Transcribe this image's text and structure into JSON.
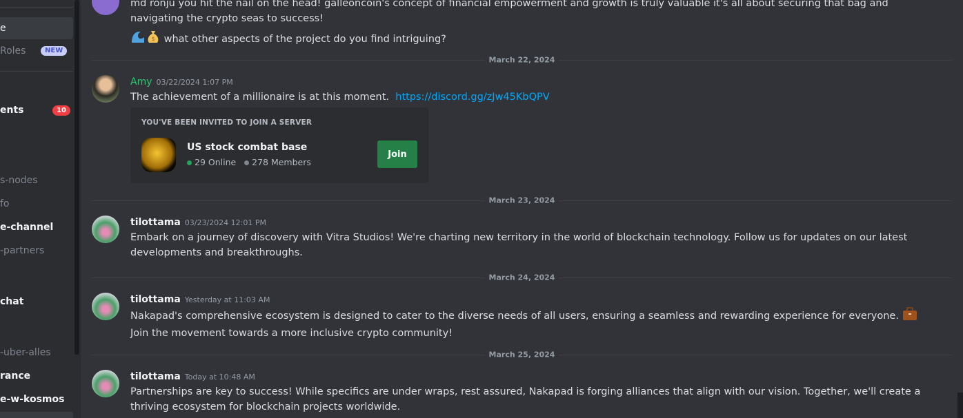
{
  "sidebar": {
    "items": [
      {
        "label": "e",
        "state": "selected"
      },
      {
        "label": "Roles",
        "badge": "NEW"
      },
      {
        "label": "ents",
        "state": "unread",
        "count": "10"
      },
      {
        "label": "s-nodes"
      },
      {
        "label": "fo"
      },
      {
        "label": "e-channel",
        "state": "unread"
      },
      {
        "label": "-partners"
      },
      {
        "label": "chat",
        "state": "unread"
      },
      {
        "label": "-uber-alles"
      },
      {
        "label": "rance",
        "state": "unread"
      },
      {
        "label": "e-w-kosmos",
        "state": "unread"
      }
    ]
  },
  "messages": [
    {
      "text1": "md ronju you hit the nail on the head! galleoncoin's concept of financial empowerment and growth is truly valuable it's all about securing that bag and navigating the crypto seas to success!",
      "text2": "what other aspects of the project do you find intriguing?",
      "emoji": [
        "wave",
        "moneybag"
      ]
    },
    {
      "date": "March 22, 2024",
      "author": "Amy",
      "author_color": "#2dc770",
      "timestamp": "03/22/2024 1:07 PM",
      "text": "The achievement of a millionaire is at this moment.",
      "link": "https://discord.gg/zJw45KbQPV",
      "invite": {
        "heading": "YOU'VE BEEN INVITED TO JOIN A SERVER",
        "server": "US stock combat base",
        "online": "29 Online",
        "members": "278 Members",
        "join_label": "Join"
      }
    },
    {
      "date": "March 23, 2024",
      "author": "tilottama",
      "timestamp": "03/23/2024 12:01 PM",
      "text": "Embark on a journey of discovery with Vitra Studios! We're charting new territory in the world of blockchain technology. Follow us for updates on our latest developments and breakthroughs."
    },
    {
      "date": "March 24, 2024",
      "author": "tilottama",
      "timestamp": "Yesterday at 11:03 AM",
      "text": "Nakapad's comprehensive ecosystem is designed to cater to the diverse needs of all users, ensuring a seamless and rewarding experience for everyone.",
      "emoji": "briefcase",
      "text_after": "Join the movement towards a more inclusive crypto community!"
    },
    {
      "date": "March 25, 2024",
      "author": "tilottama",
      "timestamp": "Today at 10:48 AM",
      "text": "Partnerships are key to success! While specifics are under wraps, rest assured, Nakapad is forging alliances that align with our vision. Together, we'll create a thriving ecosystem for blockchain projects worldwide."
    }
  ]
}
